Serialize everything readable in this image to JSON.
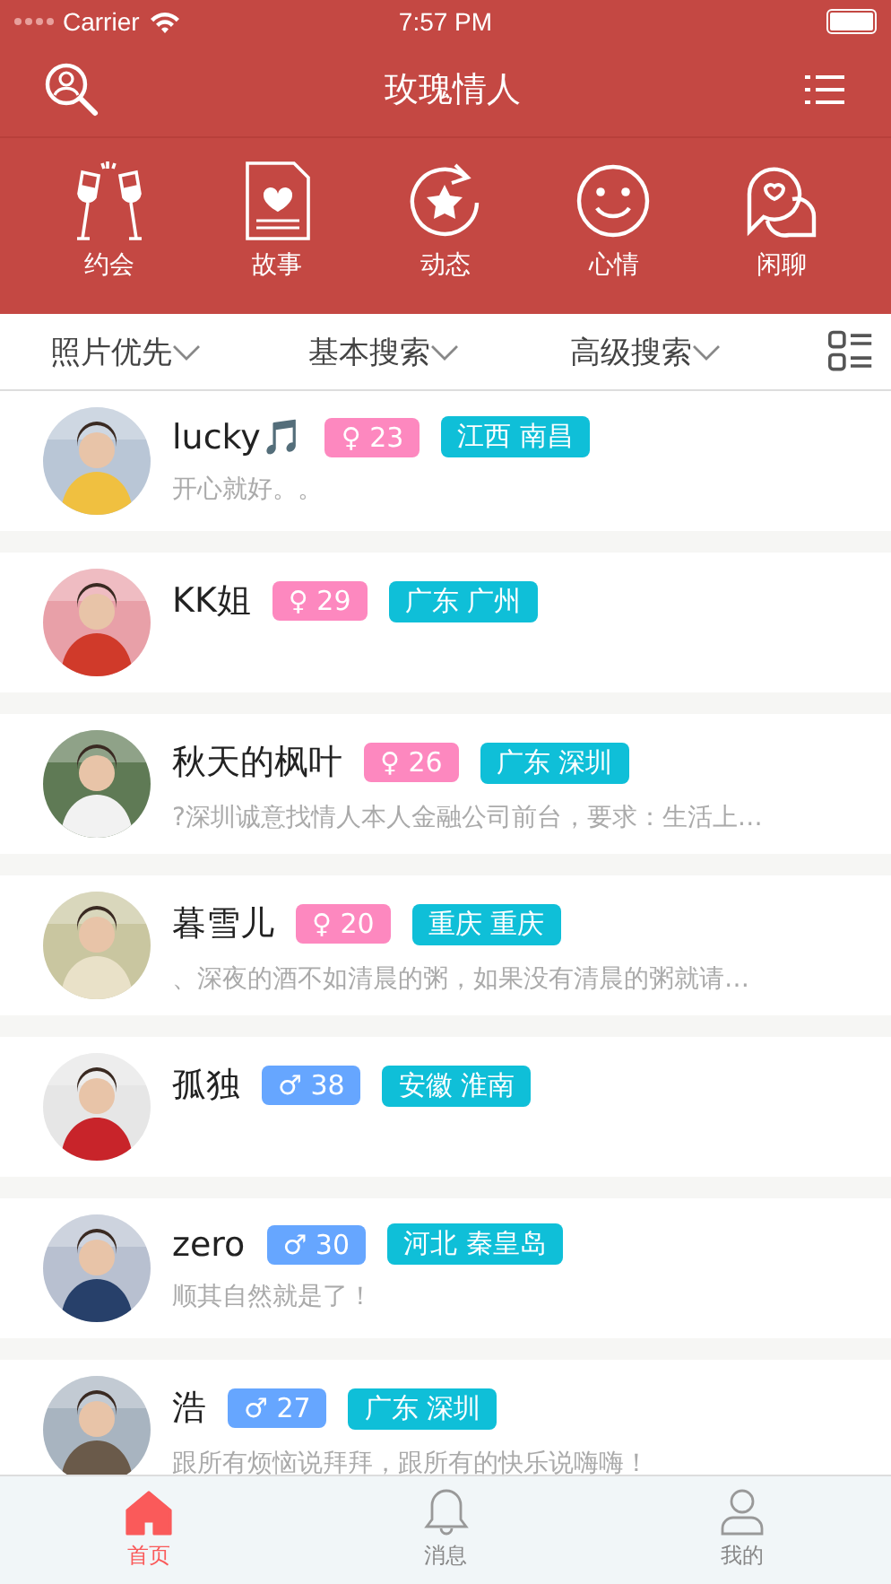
{
  "status_bar": {
    "carrier": "Carrier",
    "time": "7:57 PM"
  },
  "nav": {
    "title": "玫瑰情人"
  },
  "categories": [
    {
      "label": "约会"
    },
    {
      "label": "故事"
    },
    {
      "label": "动态"
    },
    {
      "label": "心情"
    },
    {
      "label": "闲聊"
    }
  ],
  "filters": [
    "照片优先",
    "基本搜索",
    "高级搜索"
  ],
  "users": [
    {
      "name": "lucky🎵",
      "kind": "female",
      "badge": "♀ 23",
      "location": "江西 南昌",
      "bio": "开心就好。。"
    },
    {
      "name": "KK姐",
      "kind": "female",
      "badge": "♀ 29",
      "location": "广东 广州"
    },
    {
      "name": "秋天的枫叶",
      "kind": "female",
      "badge": "♀ 26",
      "location": "广东 深圳",
      "bio": "?深圳诚意找情人本人金融公司前台，要求：生活上…"
    },
    {
      "name": "暮雪儿",
      "kind": "female",
      "badge": "♀ 20",
      "location": "重庆 重庆",
      "bio": "、深夜的酒不如清晨的粥，如果没有清晨的粥就请…"
    },
    {
      "name": "孤独",
      "kind": "male",
      "badge": "♂ 38",
      "location": "安徽 淮南"
    },
    {
      "name": "zero",
      "kind": "male",
      "badge": "♂ 30",
      "location": "河北 秦皇岛",
      "bio": "顺其自然就是了！"
    },
    {
      "name": "浩",
      "kind": "male",
      "badge": "♂ 27",
      "location": "广东 深圳",
      "bio": "跟所有烦恼说拜拜，跟所有的快乐说嗨嗨！"
    }
  ],
  "tabs": [
    {
      "label": "首页",
      "selected": true
    },
    {
      "label": "消息",
      "selected": false
    },
    {
      "label": "我的",
      "selected": false
    }
  ]
}
